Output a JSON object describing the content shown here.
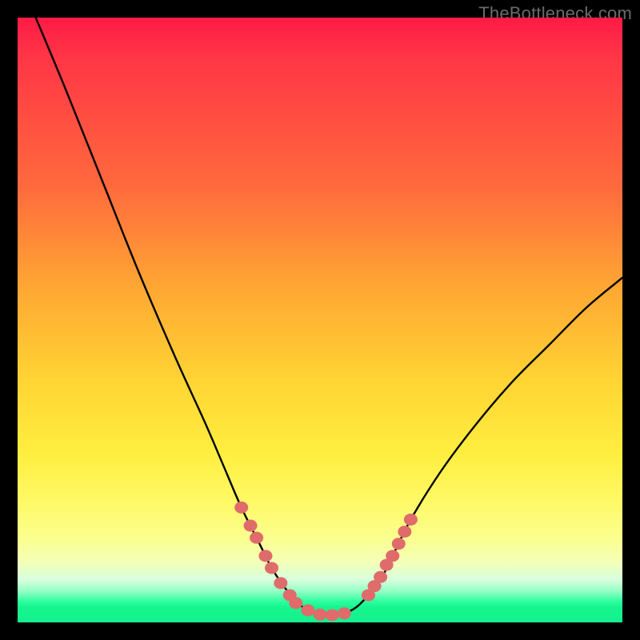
{
  "watermark": "TheBottleneck.com",
  "chart_data": {
    "type": "line",
    "title": "",
    "xlabel": "",
    "ylabel": "",
    "xlim": [
      0,
      100
    ],
    "ylim": [
      0,
      100
    ],
    "grid": false,
    "legend": false,
    "series": [
      {
        "name": "bottleneck-curve",
        "x": [
          3,
          8,
          14,
          20,
          26,
          31,
          34,
          37,
          40,
          42,
          44,
          46,
          48,
          50,
          52,
          54,
          56,
          58,
          60,
          62,
          65,
          70,
          76,
          82,
          88,
          94,
          100
        ],
        "values": [
          100,
          88,
          73,
          58,
          44,
          33,
          26,
          19,
          13,
          9,
          6,
          3.5,
          2,
          1.3,
          1.2,
          1.5,
          2.5,
          4.5,
          7,
          11,
          17,
          25,
          33,
          40,
          46,
          52,
          57
        ]
      }
    ],
    "markers": {
      "name": "highlight-beads",
      "color": "#e06b6b",
      "points": [
        {
          "x": 37,
          "y": 19
        },
        {
          "x": 38.5,
          "y": 16
        },
        {
          "x": 39.5,
          "y": 14
        },
        {
          "x": 41,
          "y": 11
        },
        {
          "x": 42,
          "y": 9
        },
        {
          "x": 43.5,
          "y": 6.5
        },
        {
          "x": 45,
          "y": 4.5
        },
        {
          "x": 46,
          "y": 3.2
        },
        {
          "x": 48,
          "y": 2
        },
        {
          "x": 50,
          "y": 1.3
        },
        {
          "x": 52,
          "y": 1.2
        },
        {
          "x": 54,
          "y": 1.5
        },
        {
          "x": 58,
          "y": 4.5
        },
        {
          "x": 59,
          "y": 6
        },
        {
          "x": 60,
          "y": 7.5
        },
        {
          "x": 61,
          "y": 9.5
        },
        {
          "x": 62,
          "y": 11
        },
        {
          "x": 63,
          "y": 13
        },
        {
          "x": 64,
          "y": 15
        },
        {
          "x": 65,
          "y": 17
        }
      ]
    }
  }
}
